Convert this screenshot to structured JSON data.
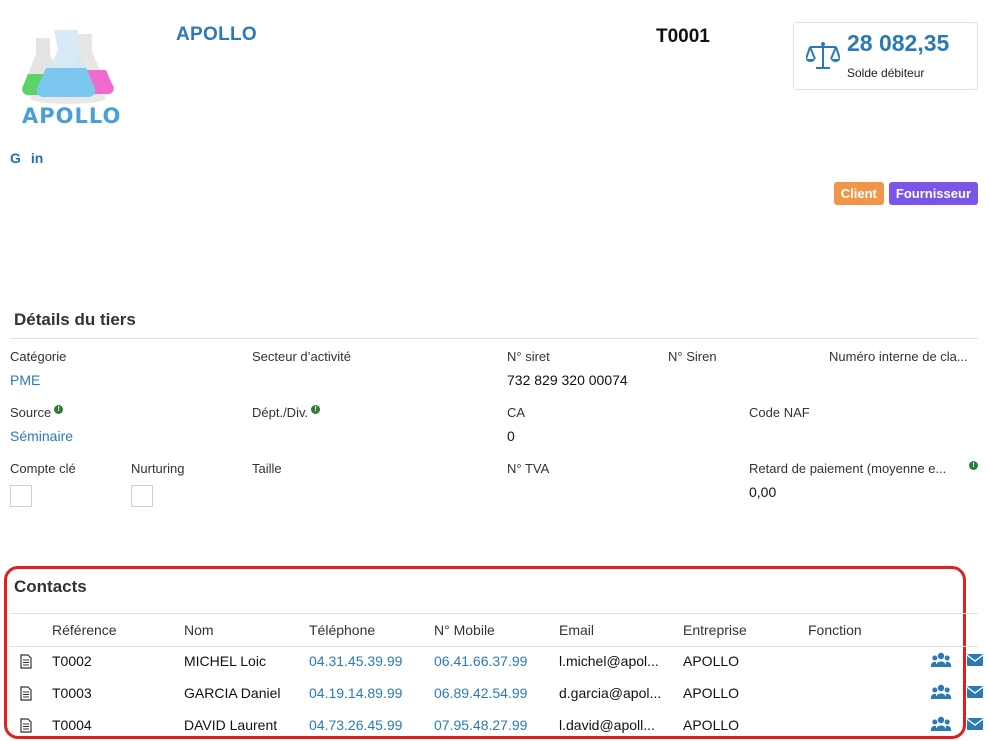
{
  "header": {
    "logo_text": "APOLLO",
    "company_name": "APOLLO",
    "reference": "T0001"
  },
  "balance": {
    "amount": "28 082,35",
    "label": "Solde débiteur",
    "icon": "scale-icon"
  },
  "social": [
    {
      "label": "G",
      "icon": "google-icon"
    },
    {
      "label": "in",
      "icon": "linkedin-icon"
    }
  ],
  "tags": {
    "client": "Client",
    "fournisseur": "Fournisseur",
    "colors": {
      "client": "#f0964a",
      "fournisseur": "#7b55e8"
    }
  },
  "details": {
    "title": "Détails du tiers",
    "categorie_label": "Catégorie",
    "categorie_value": "PME",
    "secteur_label": "Secteur d’activité",
    "siret_label": "N° siret",
    "siret_value": "732 829 320 00074",
    "siren_label": "N° Siren",
    "numero_interne_label": "Numéro interne de cla...",
    "source_label": "Source",
    "source_value": "Séminaire",
    "dept_label": "Dépt./Div.",
    "ca_label": "CA",
    "ca_value": "0",
    "code_naf_label": "Code NAF",
    "compte_cle_label": "Compte clé",
    "nurturing_label": "Nurturing",
    "taille_label": "Taille",
    "tva_label": "N° TVA",
    "retard_label": "Retard de paiement (moyenne e...",
    "retard_value": "0,00"
  },
  "contacts": {
    "title": "Contacts",
    "columns": [
      "Référence",
      "Nom",
      "Téléphone",
      "N° Mobile",
      "Email",
      "Entreprise",
      "Fonction"
    ],
    "rows": [
      {
        "ref": "T0002",
        "nom": "MICHEL Loic",
        "tel": "04.31.45.39.99",
        "mobile": "06.41.66.37.99",
        "email": "l.michel@apol...",
        "entreprise": "APOLLO",
        "fonction": ""
      },
      {
        "ref": "T0003",
        "nom": "GARCIA Daniel",
        "tel": "04.19.14.89.99",
        "mobile": "06.89.42.54.99",
        "email": "d.garcia@apol...",
        "entreprise": "APOLLO",
        "fonction": ""
      },
      {
        "ref": "T0004",
        "nom": "DAVID Laurent",
        "tel": "04.73.26.45.99",
        "mobile": "07.95.48.27.99",
        "email": "l.david@apoll...",
        "entreprise": "APOLLO",
        "fonction": ""
      }
    ]
  },
  "colors": {
    "accent": "#2a7ab8",
    "highlight": "#e02020"
  }
}
